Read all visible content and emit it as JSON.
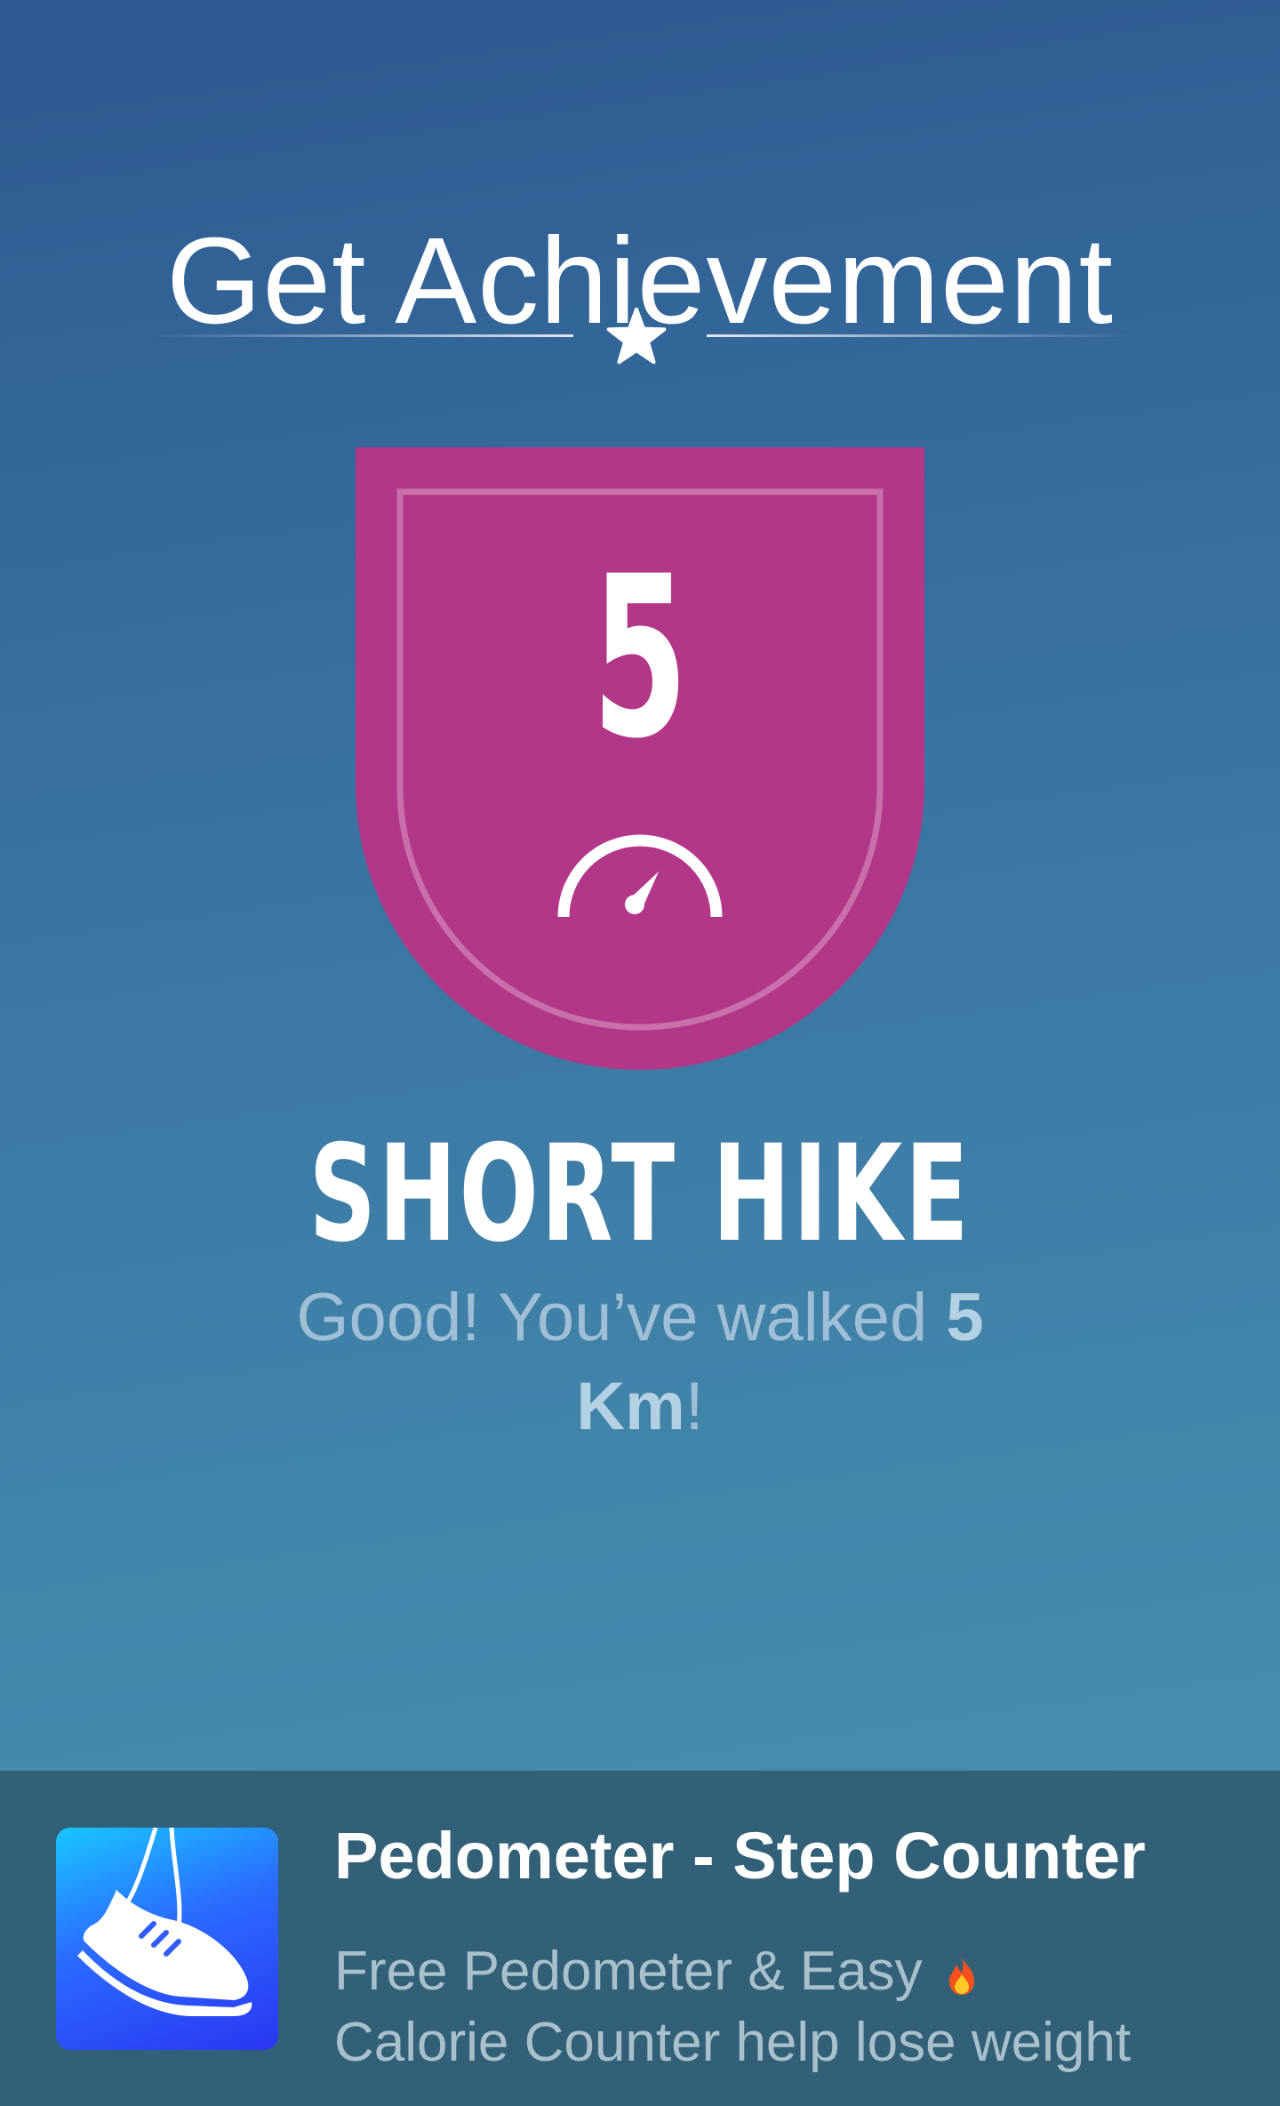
{
  "page": {
    "title": "Get Achievement"
  },
  "badge": {
    "number": "5",
    "icon": "speedometer-icon",
    "color": "#b33788"
  },
  "achievement": {
    "name": "SHORT HIKE",
    "message_prefix": "Good! You’ve walked ",
    "message_value": "5",
    "message_unit": "Km",
    "message_suffix": "!"
  },
  "ad": {
    "title": "Pedometer - Step Counter",
    "description_line1": "Free Pedometer & Easy",
    "description_line2": "Calorie Counter help lose weight",
    "icon": "sneaker-icon",
    "emoji": "fire-icon"
  },
  "colors": {
    "background_top": "#2d5990",
    "background_bottom": "#4a96b2",
    "ad_bar": "#326077"
  }
}
